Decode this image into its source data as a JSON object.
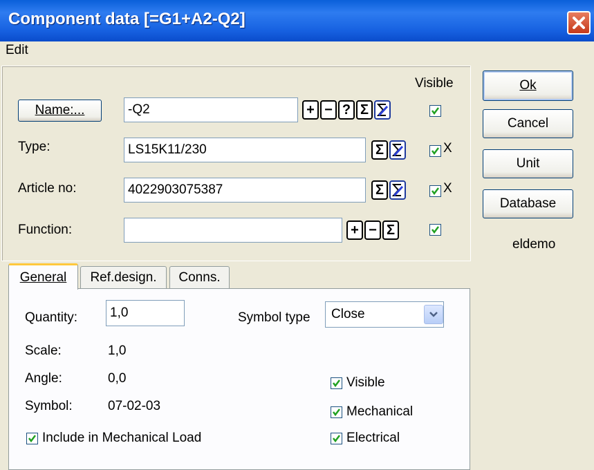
{
  "window": {
    "title": "Component data [=G1+A2-Q2]"
  },
  "menu": {
    "edit": "Edit"
  },
  "header": {
    "visible": "Visible"
  },
  "fields": {
    "name": {
      "button": "Name:...",
      "value": "-Q2"
    },
    "type": {
      "label": "Type:",
      "value": "LS15K11/230",
      "x": "X"
    },
    "article": {
      "label": "Article no:",
      "value": "4022903075387",
      "x": "X"
    },
    "function": {
      "label": "Function:",
      "value": ""
    }
  },
  "icons": {
    "plus": "+",
    "minus": "−",
    "question": "?",
    "sigma": "Σ"
  },
  "side_buttons": {
    "ok": "Ok",
    "cancel": "Cancel",
    "unit": "Unit",
    "database": "Database"
  },
  "project": "eldemo",
  "tabs": [
    "General",
    "Ref.design.",
    "Conns."
  ],
  "general": {
    "quantity_label": "Quantity:",
    "quantity_value": "1,0",
    "symbol_type_label": "Symbol type",
    "symbol_type_value": "Close",
    "scale_label": "Scale:",
    "scale_value": "1,0",
    "angle_label": "Angle:",
    "angle_value": "0,0",
    "symbol_label": "Symbol:",
    "symbol_value": "07-02-03",
    "include_mech_load": "Include in Mechanical Load",
    "visible": "Visible",
    "mechanical": "Mechanical",
    "electrical": "Electrical"
  }
}
